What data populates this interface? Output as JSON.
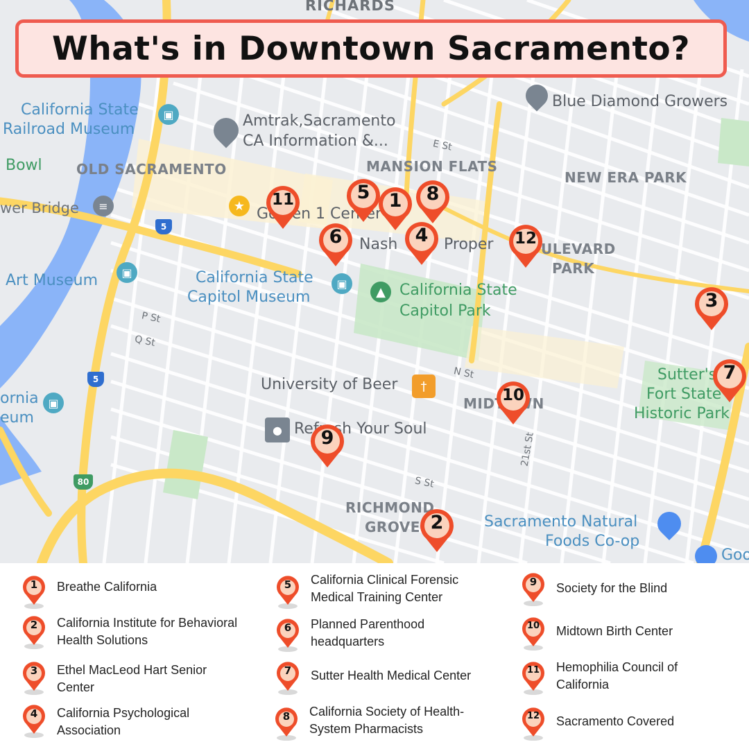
{
  "title": "What's in Downtown Sacramento?",
  "colors": {
    "pin": "#ee4d2a",
    "pin_fill": "#fbd3bd",
    "title_border": "#ef5b4f",
    "title_bg": "#fde4e1",
    "river": "#8ab4f8",
    "highway": "#fdd663",
    "road": "#ffffff",
    "park": "#c9e8c8"
  },
  "map": {
    "labels": {
      "richards": "RICHARDS",
      "railroad_museum_1": "California State",
      "railroad_museum_2": "Railroad Museum",
      "amtrak_1": "Amtrak,Sacramento",
      "amtrak_2": "CA Information &...",
      "blue_diamond": "Blue Diamond Growers",
      "e_st": "E St",
      "bowl": "Bowl",
      "old_sacramento": "OLD SACRAMENTO",
      "mansion_flats": "MANSION FLATS",
      "new_era_park": "NEW ERA PARK",
      "tower_bridge": "wer Bridge",
      "golden1": "Golden 1 Center",
      "nash": "Nash",
      "proper": "Proper",
      "boulevard": "ULEVARD",
      "park_word": "PARK",
      "art_museum": "Art Museum",
      "capitol_museum_1": "California State",
      "capitol_museum_2": "Capitol Museum",
      "capitol_park_1": "California State",
      "capitol_park_2": "Capitol Park",
      "p_st": "P St",
      "q_st": "Q St",
      "n_st": "N St",
      "university_of_beer": "University of Beer",
      "midtown": "MIDTOWN",
      "sutter_fort_1": "Sutter's",
      "sutter_fort_2": "Fort State",
      "sutter_fort_3": "Historic Park",
      "ornia": "ornia",
      "eum": "eum",
      "refresh": "Refresh Your Soul",
      "s_st": "S St",
      "st_21": "21st St",
      "richmond": "RICHMOND",
      "grove": "GROVE",
      "natural_foods_1": "Sacramento Natural",
      "natural_foods_2": "Foods Co-op",
      "goo": "Goo"
    },
    "shields": {
      "i5_top": "5",
      "i5_bottom": "5",
      "i80": "80"
    },
    "icons": {
      "museum": "museum-icon",
      "place": "place-marker-icon",
      "star": "star-icon",
      "tree": "tree-icon",
      "restaurant": "restaurant-icon",
      "shop": "shopping-cart-icon",
      "bridge": "bridge-icon"
    },
    "pins": [
      "1",
      "2",
      "3",
      "4",
      "5",
      "6",
      "7",
      "8",
      "9",
      "10",
      "11",
      "12"
    ]
  },
  "legend": [
    {
      "num": "1",
      "text": "Breathe California"
    },
    {
      "num": "2",
      "text": "California Institute for Behavioral Health Solutions"
    },
    {
      "num": "3",
      "text": "Ethel MacLeod Hart Senior Center"
    },
    {
      "num": "4",
      "text": "California Psychological Association"
    },
    {
      "num": "5",
      "text": "California Clinical Forensic Medical Training Center"
    },
    {
      "num": "6",
      "text": "Planned Parenthood headquarters"
    },
    {
      "num": "7",
      "text": "Sutter Health Medical Center"
    },
    {
      "num": "8",
      "text": "California Society of Health-System Pharmacists"
    },
    {
      "num": "9",
      "text": "Society for the Blind"
    },
    {
      "num": "10",
      "text": "Midtown Birth Center"
    },
    {
      "num": "11",
      "text": "Hemophilia Council of California"
    },
    {
      "num": "12",
      "text": "Sacramento Covered"
    }
  ]
}
